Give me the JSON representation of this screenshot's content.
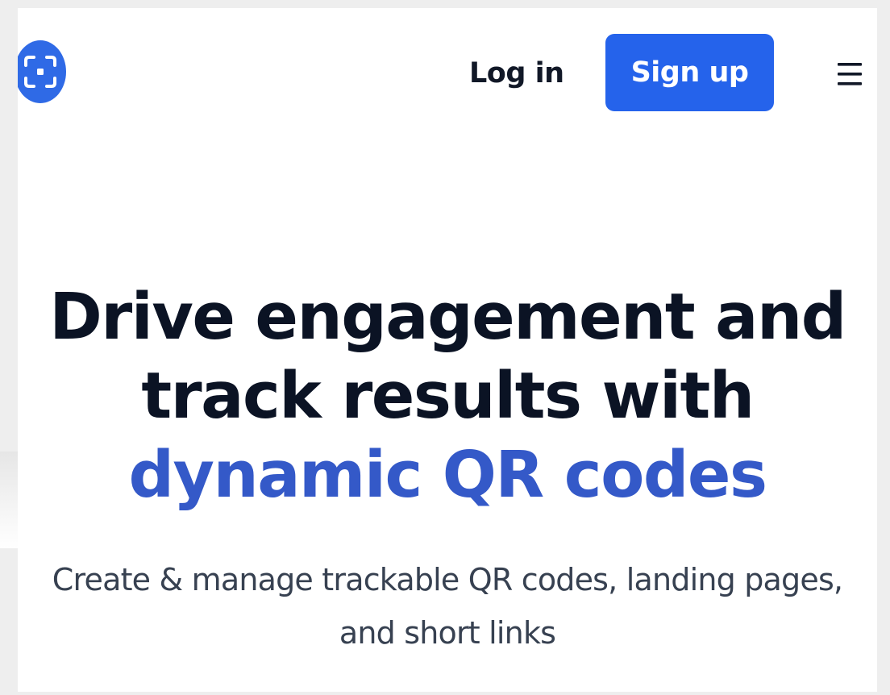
{
  "header": {
    "logo_icon": "qr-scan-frame-icon",
    "login_label": "Log in",
    "signup_label": "Sign up",
    "menu_icon": "hamburger-menu-icon"
  },
  "hero": {
    "title_part1": "Drive engagement and track results with ",
    "title_accent": "dynamic QR codes",
    "subtitle_line1": "Create & manage trackable QR codes, landing pages,",
    "subtitle_line2": "and short links"
  },
  "colors": {
    "brand_blue": "#2563eb",
    "accent_text": "#3459c8",
    "heading_text": "#0b1324",
    "body_text": "#374151"
  }
}
